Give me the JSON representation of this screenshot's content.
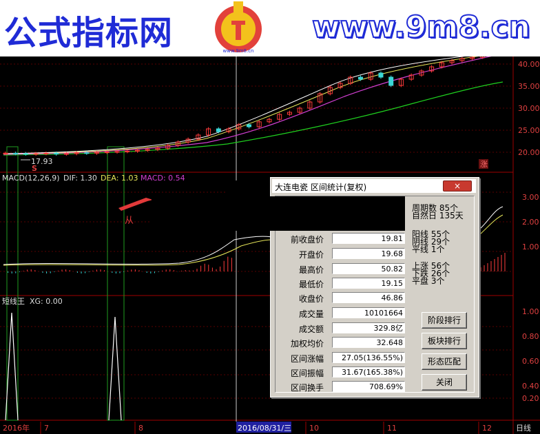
{
  "banner": {
    "left_text": "公式指标网",
    "right_text": "www.9m8.cn",
    "logo_url": "www.9m8.cn"
  },
  "price_axis": [
    "40.00",
    "35.00",
    "30.00",
    "25.00",
    "20.00"
  ],
  "price_low_label": "17.93",
  "macd": {
    "name": "MACD(12,26,9)",
    "dif": "DIF: 1.30",
    "dea": "DEA: 1.03",
    "macd": "MACD: 0.54"
  },
  "macd_axis": [
    "3.00",
    "2.00",
    "1.00"
  ],
  "xg": {
    "name": "短线王",
    "value": "XG: 0.00"
  },
  "xg_axis": [
    "1.00",
    "0.80",
    "0.60",
    "0.40",
    "0.20"
  ],
  "timeline": {
    "year": "2016年",
    "months": [
      "7",
      "8",
      "9",
      "10",
      "11",
      "12"
    ],
    "cursor_date": "2016/08/31/三",
    "period": "日线"
  },
  "markers": {
    "s": "S",
    "zhang": "涨",
    "cong": "从"
  },
  "dialog": {
    "title": "大连电瓷 区间统计(复权)",
    "close": "×",
    "rows": [
      {
        "label": "前收盘价",
        "value": "19.81"
      },
      {
        "label": "开盘价",
        "value": "19.68"
      },
      {
        "label": "最高价",
        "value": "50.82"
      },
      {
        "label": "最低价",
        "value": "19.15"
      },
      {
        "label": "收盘价",
        "value": "46.86"
      },
      {
        "label": "成交量",
        "value": "10101664"
      },
      {
        "label": "成交额",
        "value": "329.8亿"
      },
      {
        "label": "加权均价",
        "value": "32.648"
      },
      {
        "label": "区间涨幅",
        "value": "27.05(136.55%)"
      },
      {
        "label": "区间振幅",
        "value": "31.67(165.38%)"
      },
      {
        "label": "区间换手",
        "value": "708.69%"
      }
    ],
    "periods": {
      "zqs": "周期数 85个",
      "zrr": "自然日 135天"
    },
    "candle_stats": {
      "yang": "阳线 55个",
      "yin": "阴线 29个",
      "ping": "平线 1个"
    },
    "move_stats": {
      "up": "上涨 56个",
      "down": "下跌 26个",
      "flat": "平盘 3个"
    },
    "buttons": {
      "rank": "阶段排行",
      "sector": "板块排行",
      "pattern": "形态匹配",
      "close": "关闭"
    }
  },
  "chart_data": {
    "type": "line",
    "price_close": [
      19.6,
      19.5,
      19.4,
      19.5,
      19.6,
      19.4,
      19.5,
      19.7,
      19.6,
      19.8,
      19.9,
      20.0,
      20.1,
      20.3,
      20.5,
      20.8,
      21.5,
      22.3,
      23.0,
      24.0,
      25.5,
      24.8,
      25.5,
      26.5,
      26.0,
      27.2,
      27.8,
      29.0,
      29.5,
      30.5,
      32.0,
      34.0,
      35.5,
      36.5,
      38.0,
      37.5,
      39.0,
      38.0,
      36.0,
      37.5,
      38.5,
      39.5,
      40.5,
      41.5,
      42.0,
      42.5,
      42.8,
      43.5,
      44.8
    ],
    "ylim": [
      15,
      43
    ]
  }
}
